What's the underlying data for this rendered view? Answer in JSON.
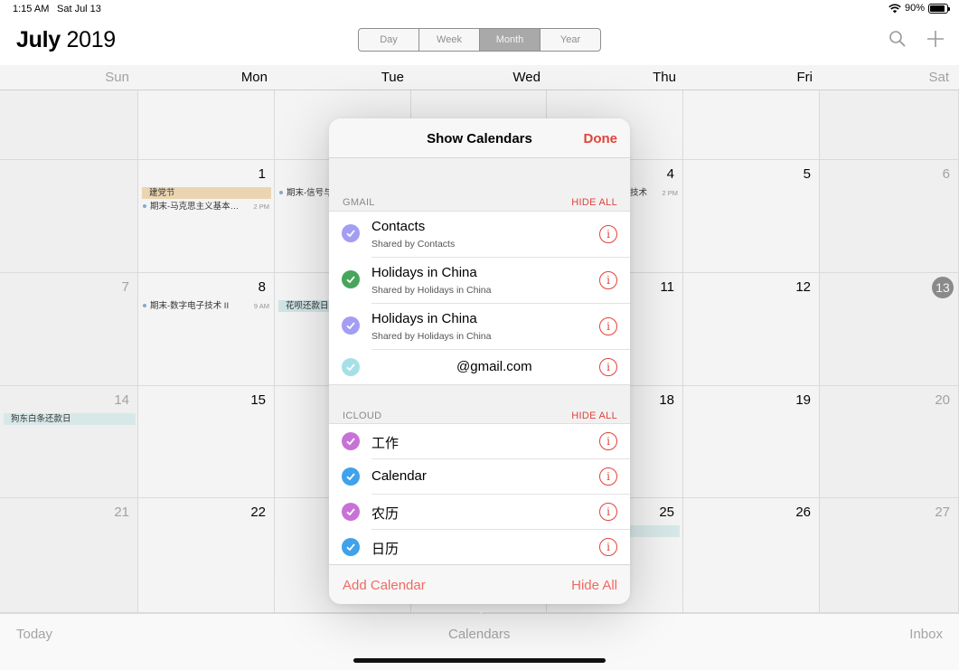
{
  "status_bar": {
    "time": "1:15 AM",
    "date": "Sat Jul 13",
    "battery": "90%"
  },
  "header": {
    "month": "July",
    "year": "2019",
    "views": [
      "Day",
      "Week",
      "Month",
      "Year"
    ],
    "active_view": "Month",
    "search_icon": "magnifying-glass",
    "add_icon": "plus"
  },
  "weekdays": [
    "Sun",
    "Mon",
    "Tue",
    "Wed",
    "Thu",
    "Fri",
    "Sat"
  ],
  "calendar": {
    "today": "13",
    "days": {
      "d1": "1",
      "d4": "4",
      "d5": "5",
      "d6": "6",
      "d7": "7",
      "d8": "8",
      "d11": "11",
      "d12": "12",
      "d13": "13",
      "d14": "14",
      "d15": "15",
      "d18": "18",
      "d19": "19",
      "d20": "20",
      "d21": "21",
      "d22": "22",
      "d25": "25",
      "d26": "26",
      "d27": "27"
    },
    "events": {
      "jiandang": "建党节",
      "makesi": "期末-马克思主义基本…",
      "makesi_time": "2 PM",
      "xinhao": "期末-信号与",
      "thu4": "技术",
      "thu4_time": "2 PM",
      "shuzi": "期末-数字电子技术 II",
      "shuzi_time": "9 AM",
      "huabei": "花呗还款日",
      "jingdong": "狗东白条还款日"
    }
  },
  "popover": {
    "title": "Show Calendars",
    "done": "Done",
    "sections": [
      {
        "name": "GMAIL",
        "hide_all": "HIDE ALL",
        "items": [
          {
            "label": "Contacts",
            "sub": "Shared by Contacts",
            "color": "#a39ef2"
          },
          {
            "label": "Holidays in China",
            "sub": "Shared by Holidays in China",
            "color": "#47a55c"
          },
          {
            "label": "Holidays in China",
            "sub": "Shared by Holidays in China",
            "color": "#a39ef2"
          },
          {
            "label": "@gmail.com",
            "sub": "",
            "color": "#a7dfe7"
          }
        ]
      },
      {
        "name": "ICLOUD",
        "hide_all": "HIDE ALL",
        "items": [
          {
            "label": "工作",
            "sub": "",
            "color": "#c772d6"
          },
          {
            "label": "Calendar",
            "sub": "",
            "color": "#3fa2ea"
          },
          {
            "label": "农历",
            "sub": "",
            "color": "#c772d6"
          },
          {
            "label": "日历",
            "sub": "",
            "color": "#3fa2ea"
          }
        ]
      }
    ],
    "add_calendar": "Add Calendar",
    "hide_all": "Hide All"
  },
  "toolbar": {
    "today": "Today",
    "calendars": "Calendars",
    "inbox": "Inbox"
  },
  "colors": {
    "accent": "#e0433a"
  }
}
